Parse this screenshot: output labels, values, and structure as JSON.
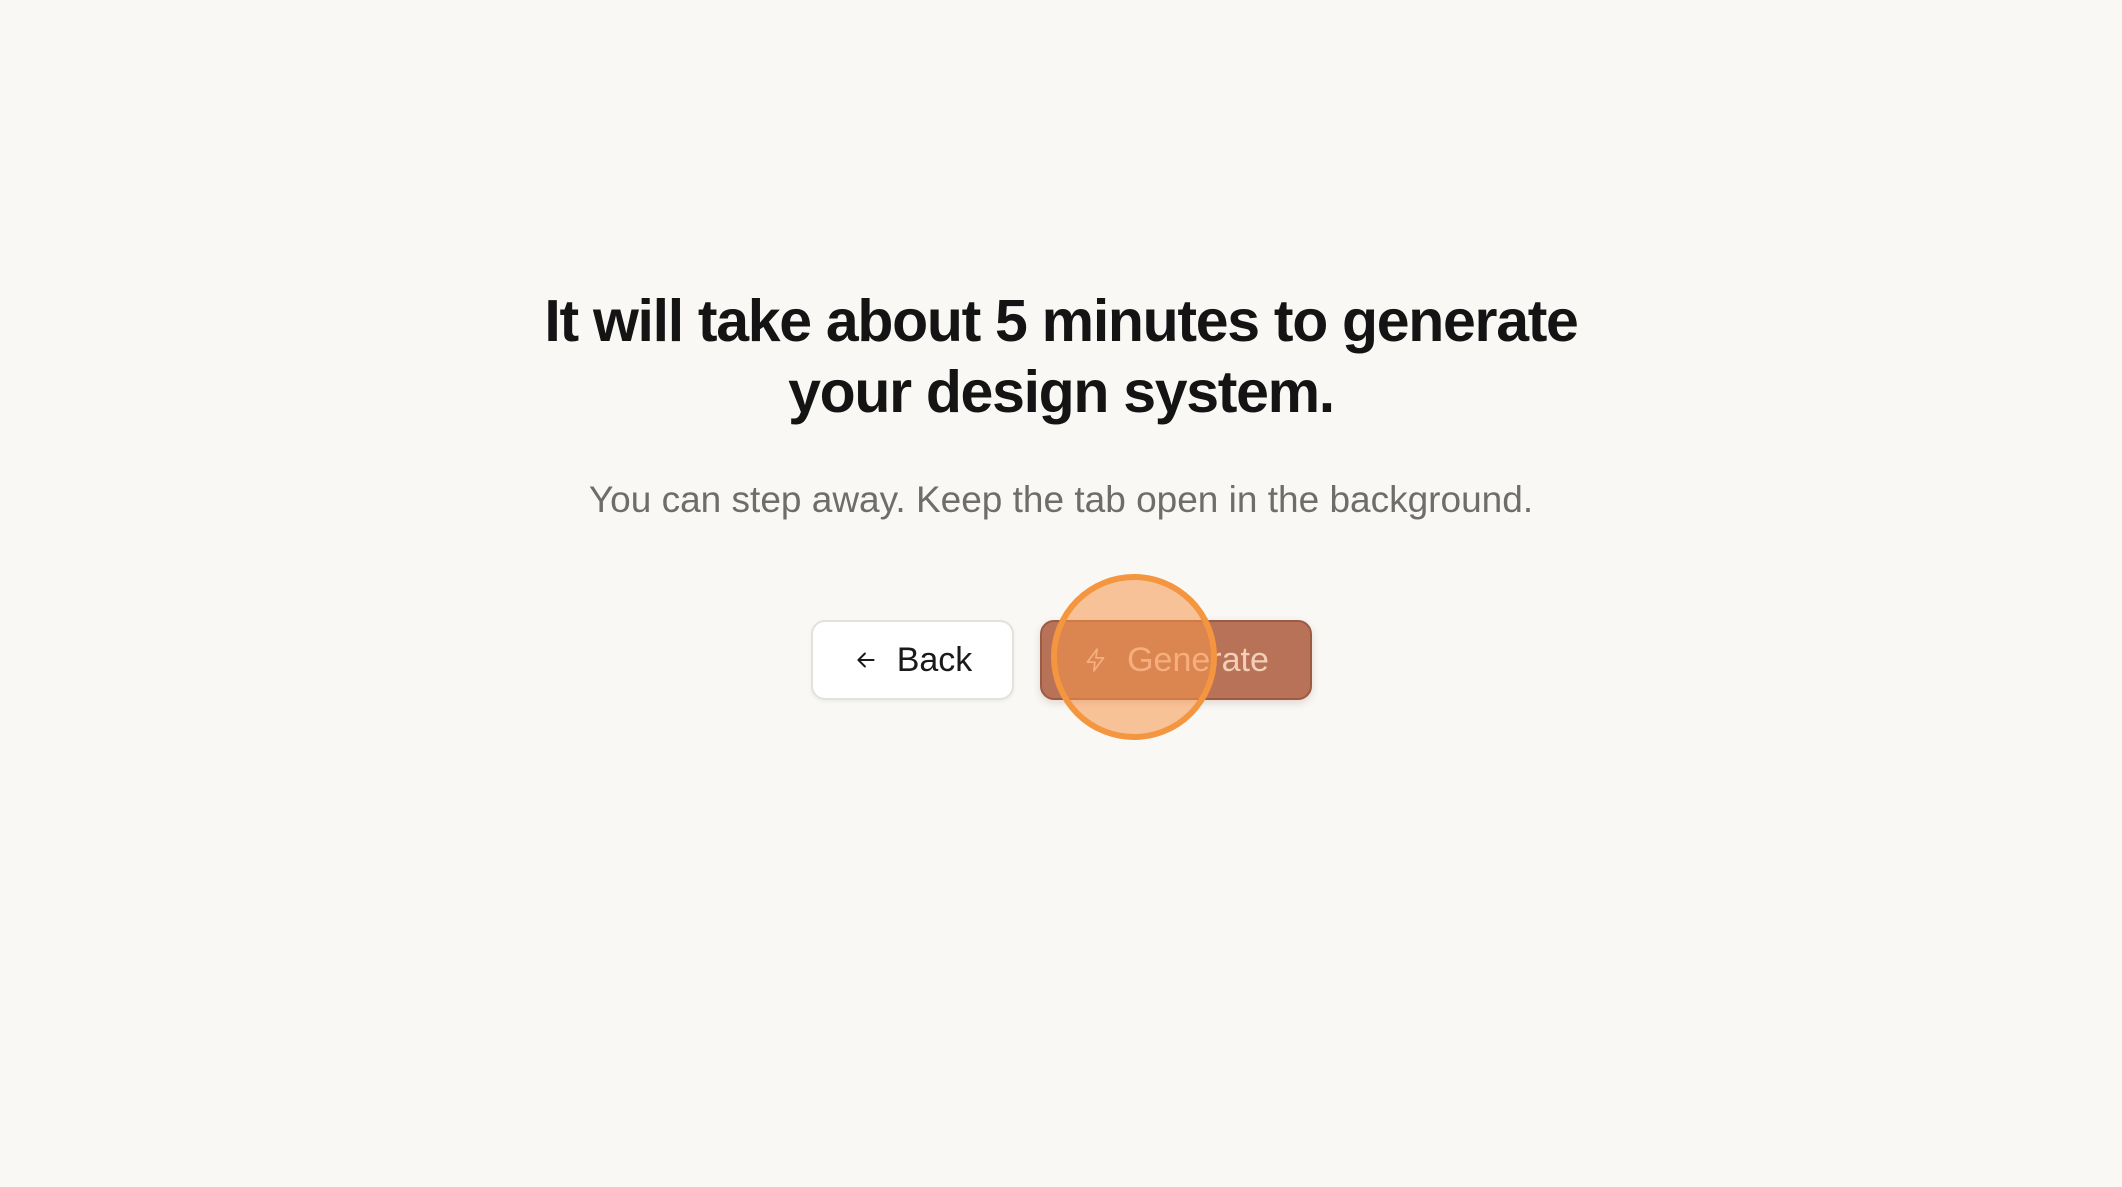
{
  "heading": {
    "line1": "It will take about 5 minutes to generate",
    "line2": "your design system."
  },
  "subtitle": "You can step away. Keep the tab open in the background.",
  "actions": {
    "back": {
      "label": "Back",
      "icon": "arrow-left-icon"
    },
    "generate": {
      "label": "Generate",
      "icon": "lightning-bolt-icon"
    }
  },
  "colors": {
    "background": "#f9f8f5",
    "heading": "#141414",
    "subtitle": "#6f6d69",
    "generate_button": "#b87258",
    "click_indicator": "#f4953f"
  }
}
